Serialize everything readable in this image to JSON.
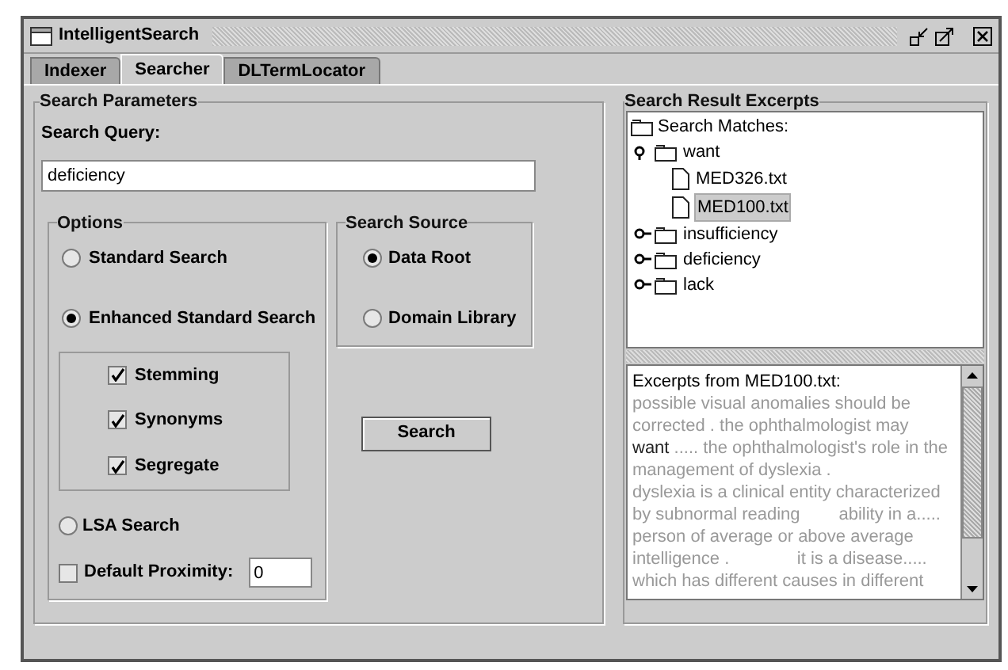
{
  "window": {
    "title": "IntelligentSearch"
  },
  "tabs": [
    {
      "label": "Indexer",
      "selected": false
    },
    {
      "label": "Searcher",
      "selected": true
    },
    {
      "label": "DLTermLocator",
      "selected": false
    }
  ],
  "search_parameters": {
    "title": "Search Parameters",
    "query_label": "Search Query:",
    "query_value": "deficiency",
    "options": {
      "title": "Options",
      "modes": [
        {
          "label": "Standard Search",
          "selected": false
        },
        {
          "label": "Enhanced Standard Search",
          "selected": true
        },
        {
          "label": "LSA Search",
          "selected": false
        }
      ],
      "enhancements": [
        {
          "label": "Stemming",
          "checked": true
        },
        {
          "label": "Synonyms",
          "checked": true
        },
        {
          "label": "Segregate",
          "checked": true
        }
      ],
      "proximity": {
        "label": "Default Proximity:",
        "checked": false,
        "value": "0"
      }
    },
    "search_source": {
      "title": "Search Source",
      "items": [
        {
          "label": "Data Root",
          "selected": true
        },
        {
          "label": "Domain Library",
          "selected": false
        }
      ]
    },
    "search_button": "Search"
  },
  "results": {
    "title": "Search Result Excerpts",
    "tree": {
      "label": "Search Matches:",
      "children": [
        {
          "label": "want",
          "expanded": true,
          "children": [
            {
              "label": "MED326.txt",
              "selected": false
            },
            {
              "label": "MED100.txt",
              "selected": true
            }
          ]
        },
        {
          "label": "insufficiency",
          "expanded": false
        },
        {
          "label": "deficiency",
          "expanded": false
        },
        {
          "label": "lack",
          "expanded": false
        }
      ]
    },
    "excerpt": {
      "title": "Excerpts from MED100.txt:",
      "lines": [
        [
          {
            "text": "possible visual anomalies should be",
            "highlight": false
          }
        ],
        [
          {
            "text": "corrected . the ophthalmologist may",
            "highlight": false
          }
        ],
        [
          {
            "text": "want",
            "highlight": true
          },
          {
            "text": " ..... the ophthalmologist's role in the",
            "highlight": false
          }
        ],
        [
          {
            "text": "management of dyslexia .",
            "highlight": false
          }
        ],
        [
          {
            "text": "dyslexia is a clinical entity characterized",
            "highlight": false
          }
        ],
        [
          {
            "text": "by subnormal reading        ability in a.....",
            "highlight": false
          }
        ],
        [
          {
            "text": "person of average or above average",
            "highlight": false
          }
        ],
        [
          {
            "text": "intelligence .              it is a disease.....",
            "highlight": false
          }
        ],
        [
          {
            "text": "which has different causes in different",
            "highlight": false
          }
        ]
      ]
    }
  }
}
